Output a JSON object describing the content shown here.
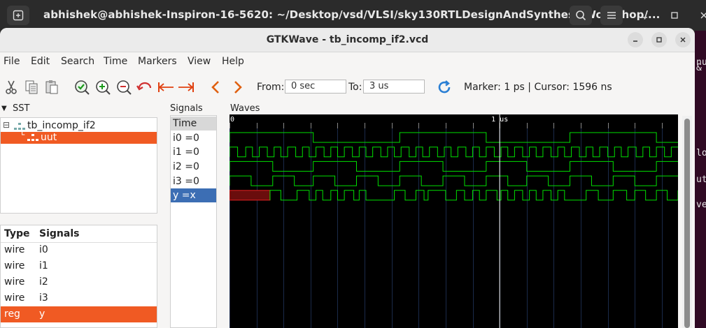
{
  "terminal": {
    "title": "abhishek@abhishek-Inspiron-16-5620: ~/Desktop/vsd/VLSI/sky130RTLDesignAndSynthesisWorkshop/...",
    "strip_glyphs": [
      "nu",
      "&",
      "lo",
      "ut",
      "ve"
    ]
  },
  "window": {
    "title": "GTKWave - tb_incomp_if2.vcd"
  },
  "menu": [
    "File",
    "Edit",
    "Search",
    "Time",
    "Markers",
    "View",
    "Help"
  ],
  "toolbar": {
    "from_label": "From:",
    "from_value": "0 sec",
    "to_label": "To:",
    "to_value": "3 us",
    "marker_text": "Marker: 1 ps  |  Cursor: 1596 ns"
  },
  "sst": {
    "header": "SST",
    "tree": [
      {
        "label": "tb_incomp_if2",
        "selected": false
      },
      {
        "label": "uut",
        "selected": true
      }
    ]
  },
  "signal_list": {
    "headers": {
      "type": "Type",
      "signals": "Signals"
    },
    "rows": [
      {
        "type": "wire",
        "name": "i0",
        "selected": false
      },
      {
        "type": "wire",
        "name": "i1",
        "selected": false
      },
      {
        "type": "wire",
        "name": "i2",
        "selected": false
      },
      {
        "type": "wire",
        "name": "i3",
        "selected": false
      },
      {
        "type": "reg",
        "name": "y",
        "selected": true
      }
    ]
  },
  "signals_panel": {
    "header": "Signals",
    "time_label": "Time",
    "rows": [
      {
        "label": "i0 =0",
        "selected": false
      },
      {
        "label": "i1 =0",
        "selected": false
      },
      {
        "label": "i2 =0",
        "selected": false
      },
      {
        "label": "i3 =0",
        "selected": false
      },
      {
        "label": "y =x",
        "selected": true
      }
    ]
  },
  "waves": {
    "header": "Waves",
    "time_range_ns": [
      0,
      1660
    ],
    "timescale": {
      "zero_label": "0",
      "one_us_label": "1 us"
    },
    "cursor_ns": 1000,
    "colors": {
      "wave": "#00e000",
      "grid": "#1a2a4a",
      "unknown": "#e02020",
      "cursor": "#ffffff"
    },
    "signals": [
      {
        "name": "i0",
        "transitions_ns": [
          0,
          310,
          630,
          950,
          1260,
          1580
        ]
      },
      {
        "name": "i1",
        "transitions_ns": [
          0,
          30,
          60,
          85,
          110,
          140,
          165,
          190,
          215,
          245,
          270,
          295,
          320,
          350,
          375,
          400,
          425,
          455,
          480,
          505,
          530,
          560,
          585,
          610,
          635,
          665,
          690,
          715,
          740,
          770,
          795,
          820,
          845,
          875,
          900,
          925,
          950,
          980,
          1005,
          1030,
          1055,
          1085,
          1110,
          1135,
          1160,
          1190,
          1215,
          1240,
          1265,
          1295,
          1320,
          1345,
          1370,
          1400,
          1425,
          1450,
          1475,
          1505,
          1530,
          1555,
          1580,
          1610,
          1635
        ]
      },
      {
        "name": "i2",
        "transitions_ns": [
          0,
          160,
          310,
          470,
          630,
          790,
          950,
          1100,
          1260,
          1420,
          1580
        ]
      },
      {
        "name": "i3",
        "transitions_ns": [
          0,
          80,
          160,
          240,
          310,
          390,
          470,
          550,
          630,
          710,
          790,
          870,
          950,
          1030,
          1100,
          1180,
          1260,
          1340,
          1420,
          1500,
          1580
        ]
      },
      {
        "name": "y",
        "unknown_until_ns": 150,
        "transitions_ns": [
          150,
          190,
          250,
          295,
          320,
          345,
          375,
          400,
          425,
          460,
          480,
          505,
          610,
          650,
          690,
          720,
          735,
          800,
          840,
          870,
          900,
          925,
          950,
          990,
          1005,
          1030,
          1055,
          1085,
          1110,
          1135,
          1160,
          1190,
          1215,
          1240,
          1320,
          1365,
          1420,
          1470,
          1500,
          1540,
          1580,
          1620,
          1660
        ]
      }
    ]
  }
}
